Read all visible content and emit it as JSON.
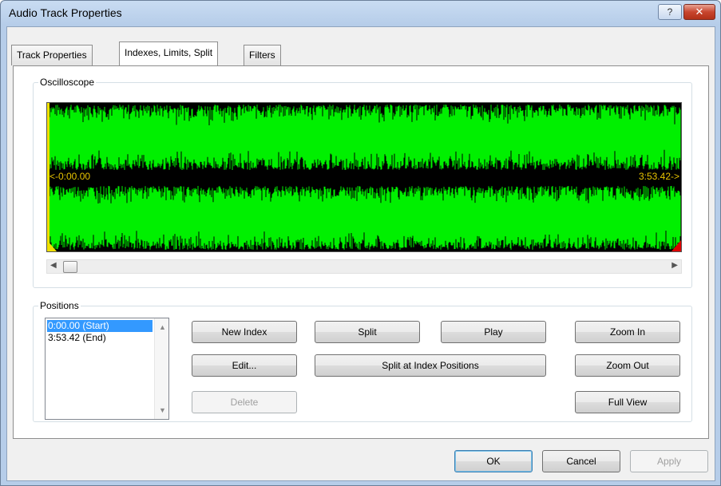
{
  "window": {
    "title": "Audio Track Properties",
    "help_glyph": "?",
    "close_glyph": "✕"
  },
  "tabs": [
    {
      "label": "Track Properties",
      "active": false
    },
    {
      "label": "Indexes, Limits, Split",
      "active": true
    },
    {
      "label": "Filters",
      "active": false
    }
  ],
  "oscilloscope": {
    "group_label": "Oscilloscope",
    "start_marker": "<-0:00.00",
    "end_marker": "3:53.42->",
    "waveform_color": "#00f000",
    "background_color": "#000000",
    "start_flag_color": "#f0e000",
    "end_flag_color": "#e00000",
    "scroll_position": 0.0
  },
  "positions": {
    "group_label": "Positions",
    "items": [
      {
        "label": "0:00.00 (Start)",
        "selected": true
      },
      {
        "label": "3:53.42 (End)",
        "selected": false
      }
    ]
  },
  "buttons": {
    "new_index": "New Index",
    "edit": "Edit...",
    "delete": "Delete",
    "split": "Split",
    "split_at_index": "Split at Index Positions",
    "play": "Play",
    "zoom_in": "Zoom In",
    "zoom_out": "Zoom Out",
    "full_view": "Full View"
  },
  "footer": {
    "ok": "OK",
    "cancel": "Cancel",
    "apply": "Apply"
  },
  "icons": {
    "scroll_left": "◀",
    "scroll_right": "▶",
    "scroll_up": "▲",
    "scroll_down": "▼"
  }
}
